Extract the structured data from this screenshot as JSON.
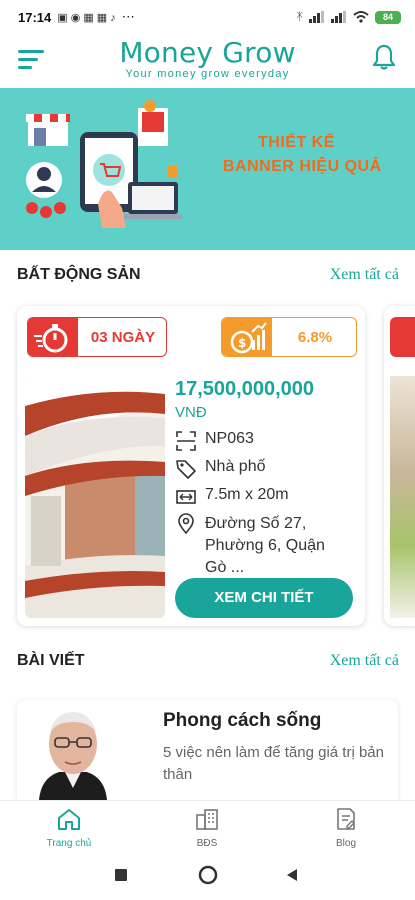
{
  "status_bar": {
    "time": "17:14",
    "notif": "⋯",
    "battery": "84"
  },
  "app": {
    "title": "Money Grow",
    "tagline": "Your money grow everyday"
  },
  "banner": {
    "line1": "THIẾT KẾ",
    "line2": "BANNER HIỆU QUẢ"
  },
  "real_estate": {
    "section_title": "BẤT ĐỘNG SẢN",
    "see_all": "Xem tất cả",
    "card": {
      "days_badge": "03 NGÀY",
      "rate_badge": "6.8%",
      "price": "17,500,000,000",
      "currency": "VNĐ",
      "code": "NP063",
      "type": "Nhà phố",
      "size": "7.5m x 20m",
      "address": "Đường Số 27, Phường 6, Quận Gò ...",
      "button": "XEM CHI TIẾT"
    }
  },
  "posts": {
    "section_title": "BÀI VIẾT",
    "see_all": "Xem tất cả",
    "item": {
      "title": "Phong cách sống",
      "desc": "5 việc nên làm để tăng giá trị bản thân"
    }
  },
  "bottom_nav": [
    {
      "label": "Trang chủ",
      "active": true
    },
    {
      "label": "BĐS",
      "active": false
    },
    {
      "label": "Blog",
      "active": false
    }
  ],
  "colors": {
    "accent": "#1aa59a",
    "red": "#e53935",
    "orange": "#f39c2b",
    "banner_bg": "#5fd0c8"
  }
}
